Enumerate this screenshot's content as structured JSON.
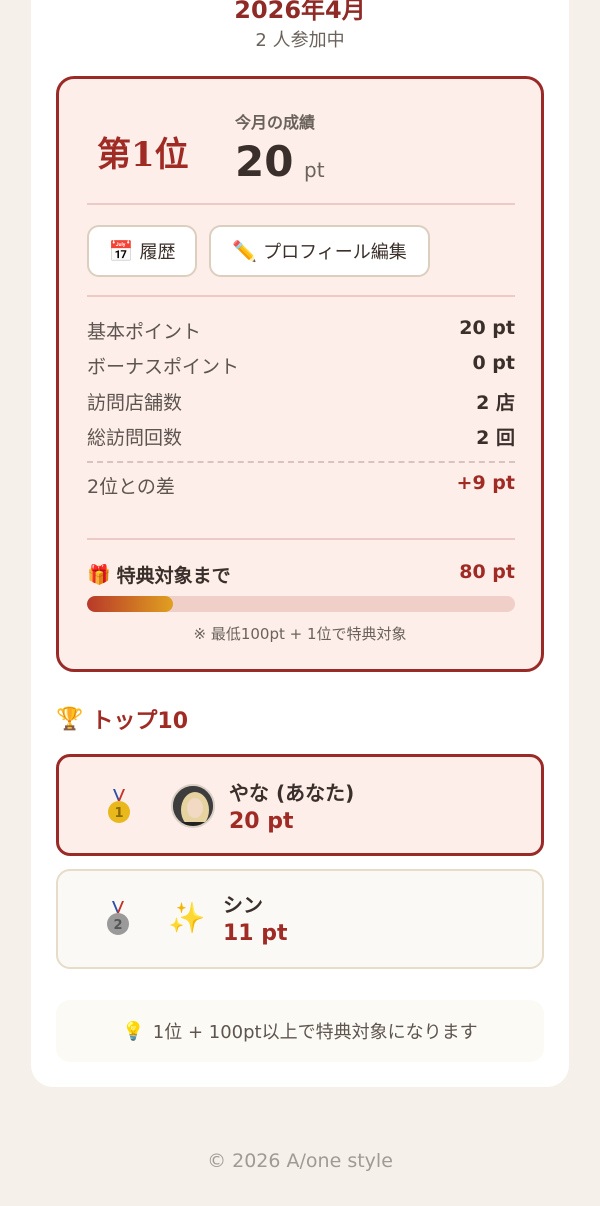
{
  "header": {
    "month_title": "2026年4月",
    "participants": "2 人参加中"
  },
  "my_rank": {
    "rank_label": "第1位",
    "month_label": "今月の成績",
    "points": "20",
    "unit": "pt"
  },
  "actions": {
    "history_label": "履歴",
    "profile_edit_label": "プロフィール編集"
  },
  "stats": [
    {
      "label": "基本ポイント",
      "value": "20 pt"
    },
    {
      "label": "ボーナスポイント",
      "value": "0 pt"
    },
    {
      "label": "訪問店舗数",
      "value": "2 店"
    },
    {
      "label": "総訪問回数",
      "value": "2 回"
    }
  ],
  "diff": {
    "label": "2位との差",
    "value": "+9 pt"
  },
  "benefit": {
    "label": "特典対象まで",
    "value": "80 pt",
    "progress": 0.2,
    "note": "※ 最低100pt + 1位で特典対象"
  },
  "top10": {
    "title": "トップ10",
    "entries": [
      {
        "rank": 1,
        "name": "やな (あなた)",
        "points": "20 pt",
        "medal_color": "#e8b81c"
      },
      {
        "rank": 2,
        "name": "シン",
        "points": "11 pt",
        "medal_color": "#9a9a9a"
      }
    ]
  },
  "tip": "1位 + 100pt以上で特典対象になります",
  "footer": "© 2026 A/one style",
  "colors": {
    "accent": "#a02b25",
    "background": "#f5f1ea",
    "rank_box_bg": "#fdeee9"
  }
}
